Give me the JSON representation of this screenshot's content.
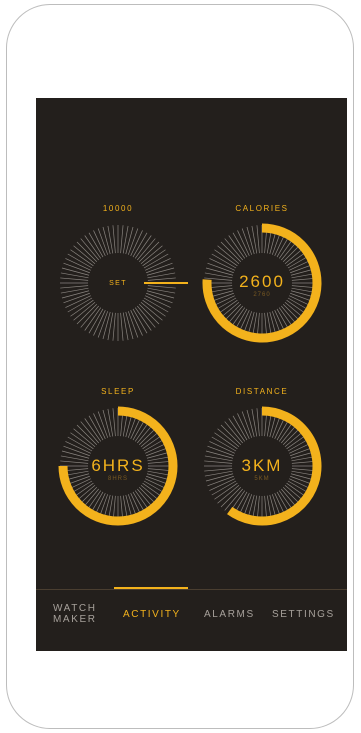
{
  "colors": {
    "accent": "#f3b21c",
    "background": "#231f1c",
    "tick": "#8a8580",
    "muted": "#a6a09a"
  },
  "gauges": [
    {
      "id": "steps",
      "label": "10000",
      "center_text": "SET",
      "sub_text": "",
      "progress": 0.0,
      "has_handle": true
    },
    {
      "id": "calories",
      "label": "CALORIES",
      "center_text": "2600",
      "sub_text": "2760",
      "progress": 0.76,
      "has_handle": false
    },
    {
      "id": "sleep",
      "label": "SLEEP",
      "center_text": "6HRS",
      "sub_text": "8HRS",
      "progress": 0.75,
      "has_handle": false
    },
    {
      "id": "distance",
      "label": "DISTANCE",
      "center_text": "3KM",
      "sub_text": "5KM",
      "progress": 0.6,
      "has_handle": false
    }
  ],
  "nav": {
    "items": [
      {
        "label_line1": "WATCH",
        "label_line2": "MAKER",
        "active": false
      },
      {
        "label_line1": "ACTIVITY",
        "label_line2": "",
        "active": true
      },
      {
        "label_line1": "ALARMS",
        "label_line2": "",
        "active": false
      },
      {
        "label_line1": "SETTINGS",
        "label_line2": "",
        "active": false
      }
    ]
  }
}
